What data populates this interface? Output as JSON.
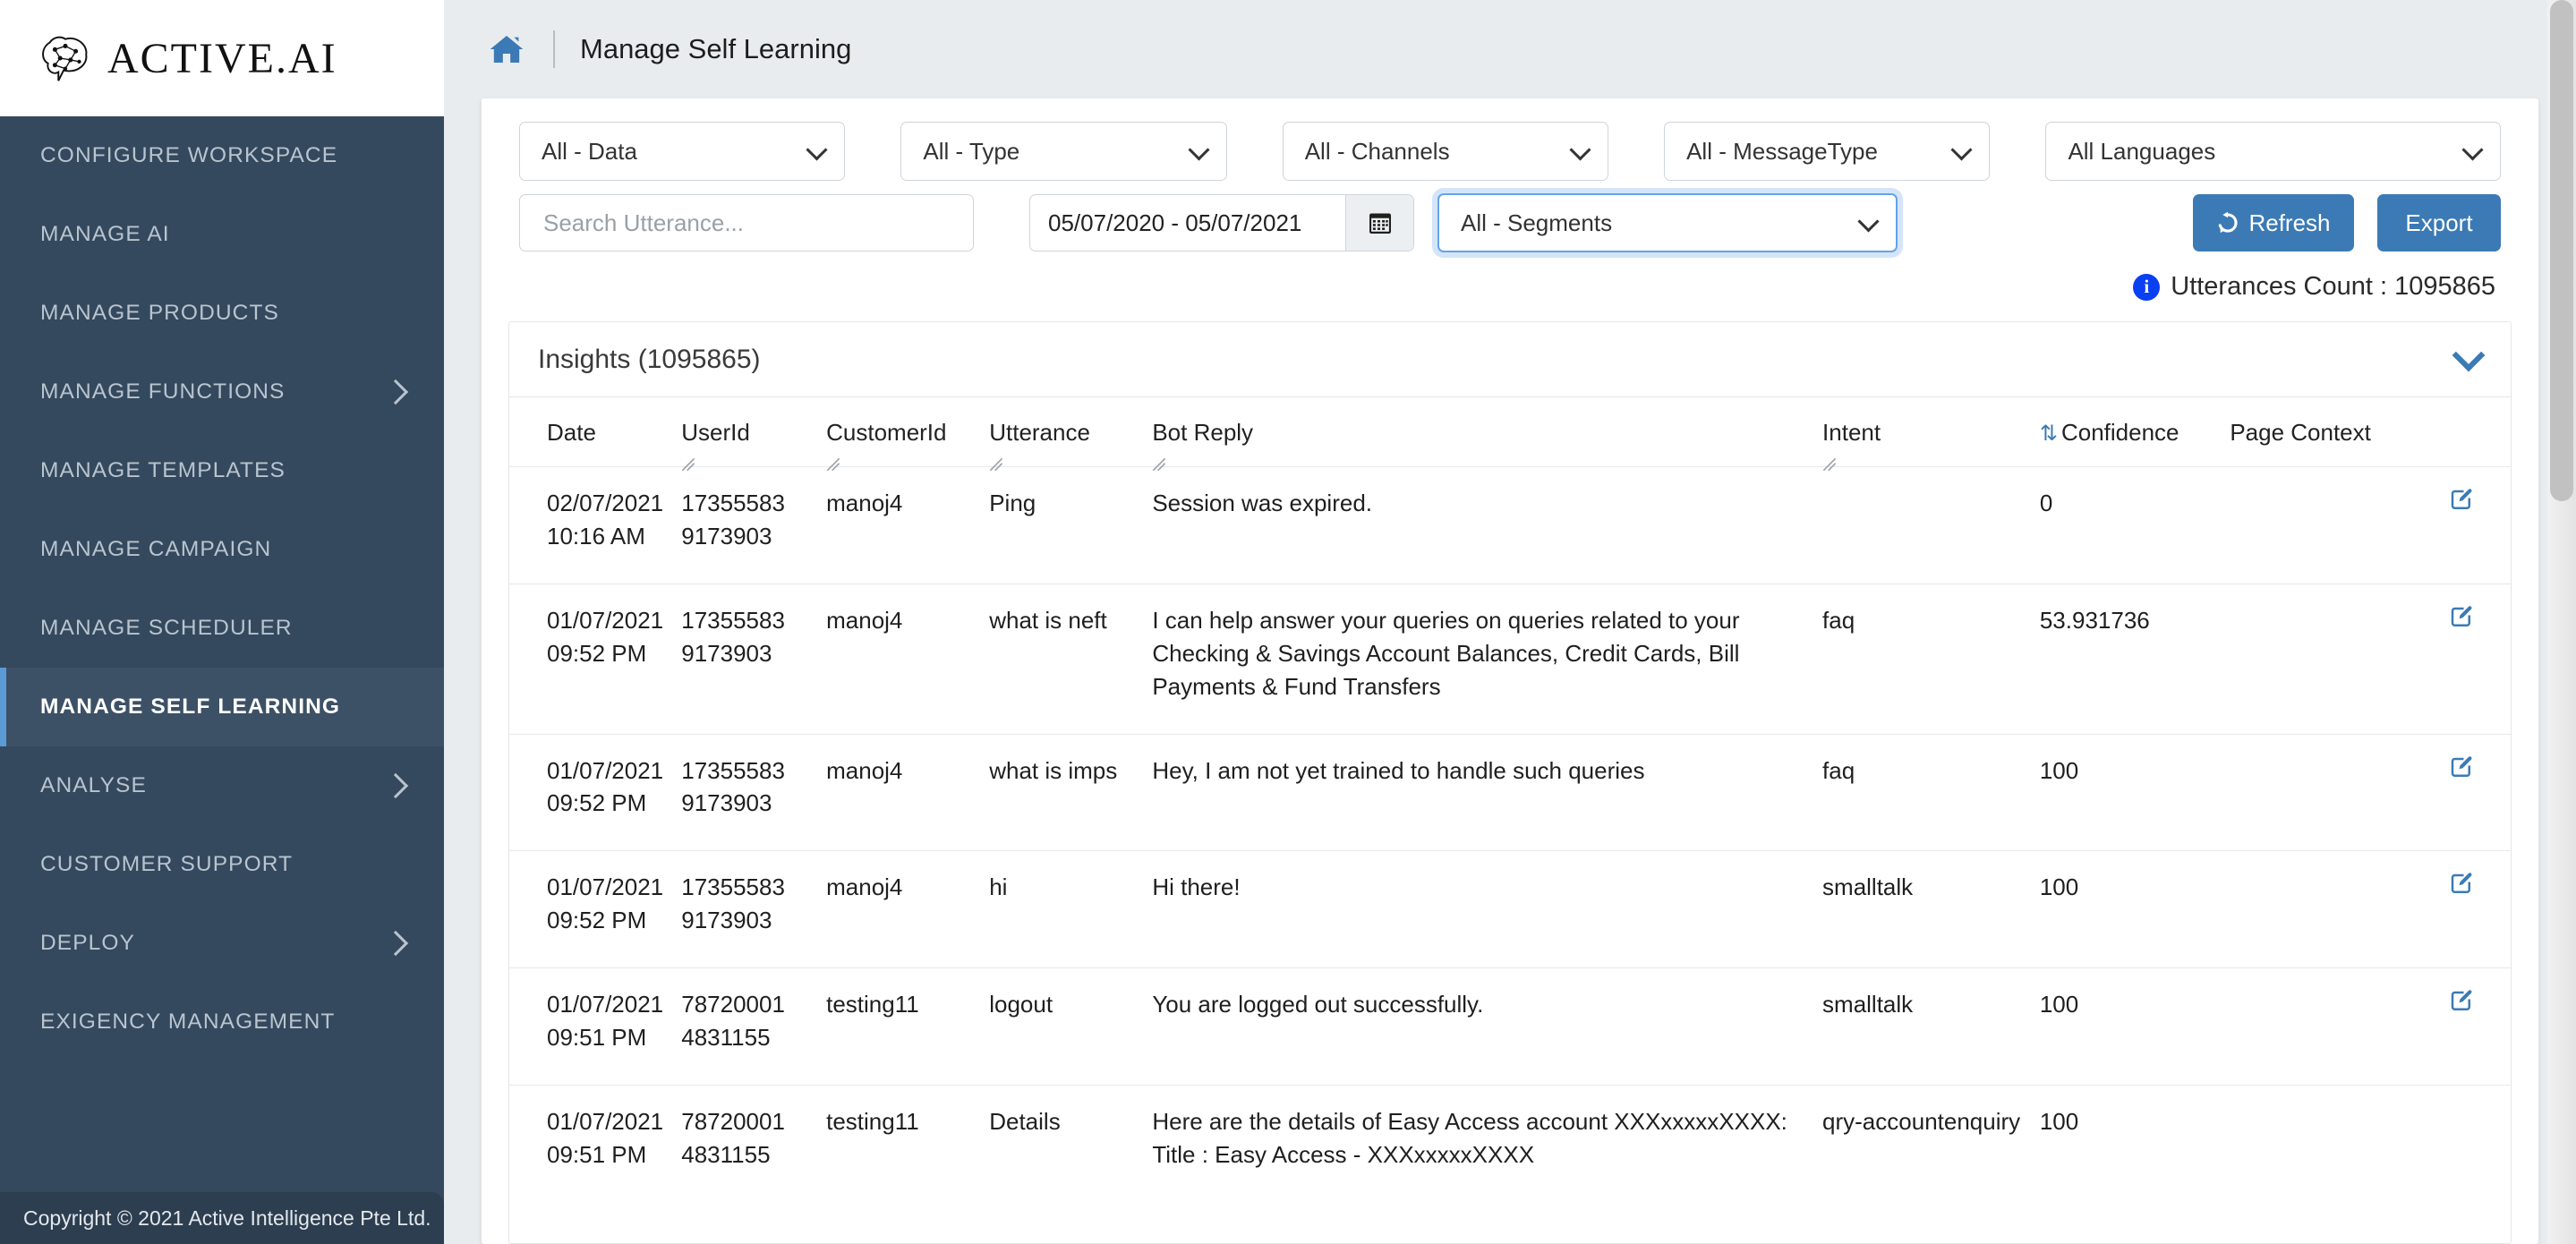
{
  "brand": {
    "name": "ACTIVE.AI",
    "logo_icon": "brain-network-icon"
  },
  "sidebar": {
    "items": [
      {
        "label": "CONFIGURE WORKSPACE",
        "has_chevron": false,
        "active": false
      },
      {
        "label": "MANAGE AI",
        "has_chevron": false,
        "active": false
      },
      {
        "label": "MANAGE PRODUCTS",
        "has_chevron": false,
        "active": false
      },
      {
        "label": "MANAGE FUNCTIONS",
        "has_chevron": true,
        "active": false
      },
      {
        "label": "MANAGE TEMPLATES",
        "has_chevron": false,
        "active": false
      },
      {
        "label": "MANAGE CAMPAIGN",
        "has_chevron": false,
        "active": false
      },
      {
        "label": "MANAGE SCHEDULER",
        "has_chevron": false,
        "active": false
      },
      {
        "label": "MANAGE SELF LEARNING",
        "has_chevron": false,
        "active": true
      },
      {
        "label": "ANALYSE",
        "has_chevron": true,
        "active": false
      },
      {
        "label": "CUSTOMER SUPPORT",
        "has_chevron": false,
        "active": false
      },
      {
        "label": "DEPLOY",
        "has_chevron": true,
        "active": false
      },
      {
        "label": "EXIGENCY MANAGEMENT",
        "has_chevron": false,
        "active": false
      }
    ],
    "copyright": "Copyright © 2021 Active Intelligence Pte Ltd."
  },
  "topbar": {
    "home_icon": "home-icon",
    "breadcrumb_title": "Manage Self Learning"
  },
  "filters": {
    "data": "All - Data",
    "type": "All - Type",
    "channels": "All - Channels",
    "message_type": "All - MessageType",
    "languages": "All Languages",
    "search_placeholder": "Search Utterance...",
    "search_value": "",
    "date_range": "05/07/2020 - 05/07/2021",
    "calendar_icon": "calendar-icon",
    "segments": "All - Segments",
    "refresh_label": "Refresh",
    "refresh_icon": "refresh-icon",
    "export_label": "Export"
  },
  "utterances_count_label": "Utterances Count : 1095865",
  "insights": {
    "title": "Insights (1095865)",
    "collapse_icon": "chevron-down-icon",
    "columns": [
      {
        "label": "Date",
        "sortable": false,
        "resizable": false
      },
      {
        "label": "UserId",
        "sortable": false,
        "resizable": true
      },
      {
        "label": "CustomerId",
        "sortable": false,
        "resizable": true
      },
      {
        "label": "Utterance",
        "sortable": false,
        "resizable": true
      },
      {
        "label": "Bot Reply",
        "sortable": false,
        "resizable": true
      },
      {
        "label": "Intent",
        "sortable": false,
        "resizable": true
      },
      {
        "label": "Confidence",
        "sortable": true,
        "resizable": false
      },
      {
        "label": "Page Context",
        "sortable": false,
        "resizable": false
      },
      {
        "label": "",
        "sortable": false,
        "resizable": false
      }
    ],
    "rows": [
      {
        "date": "02/07/2021\n10:16 AM",
        "user_id": "17355583\n9173903",
        "customer_id": "manoj4",
        "utterance": "Ping",
        "bot_reply": "Session was expired.",
        "intent": "",
        "confidence": "0",
        "page_context": "",
        "edit_icon": "edit-icon"
      },
      {
        "date": "01/07/2021\n09:52 PM",
        "user_id": "17355583\n9173903",
        "customer_id": "manoj4",
        "utterance": "what is neft",
        "bot_reply": "I can help answer your queries on queries related to your Checking & Savings Account Balances, Credit Cards, Bill Payments & Fund Transfers",
        "intent": "faq",
        "confidence": "53.931736",
        "page_context": "",
        "edit_icon": "edit-icon"
      },
      {
        "date": "01/07/2021\n09:52 PM",
        "user_id": "17355583\n9173903",
        "customer_id": "manoj4",
        "utterance": "what is imps",
        "bot_reply": "Hey, I am not yet trained to handle such queries",
        "intent": "faq",
        "confidence": "100",
        "page_context": "",
        "edit_icon": "edit-icon"
      },
      {
        "date": "01/07/2021\n09:52 PM",
        "user_id": "17355583\n9173903",
        "customer_id": "manoj4",
        "utterance": "hi",
        "bot_reply": "Hi there!",
        "intent": "smalltalk",
        "confidence": "100",
        "page_context": "",
        "edit_icon": "edit-icon"
      },
      {
        "date": "01/07/2021\n09:51 PM",
        "user_id": "78720001\n4831155",
        "customer_id": "testing11",
        "utterance": "logout",
        "bot_reply": "You are logged out successfully.",
        "intent": "smalltalk",
        "confidence": "100",
        "page_context": "",
        "edit_icon": "edit-icon"
      },
      {
        "date": "01/07/2021\n09:51 PM",
        "user_id": "78720001\n4831155",
        "customer_id": "testing11",
        "utterance": "Details",
        "bot_reply": "Here are the details of Easy Access account XXXxxxxxXXXX:\nTitle : Easy Access - XXXxxxxxXXXX",
        "intent": "qry-accountenquiry",
        "confidence": "100",
        "page_context": "",
        "edit_icon": "edit-icon"
      }
    ]
  },
  "colors": {
    "sidebar_bg": "#34495e",
    "sidebar_active_bg": "#3d5166",
    "accent_blue": "#3b7ab5",
    "focus_blue": "#64a3e8",
    "info_blue": "#0a3ff2",
    "page_bg": "#e9ecef"
  }
}
